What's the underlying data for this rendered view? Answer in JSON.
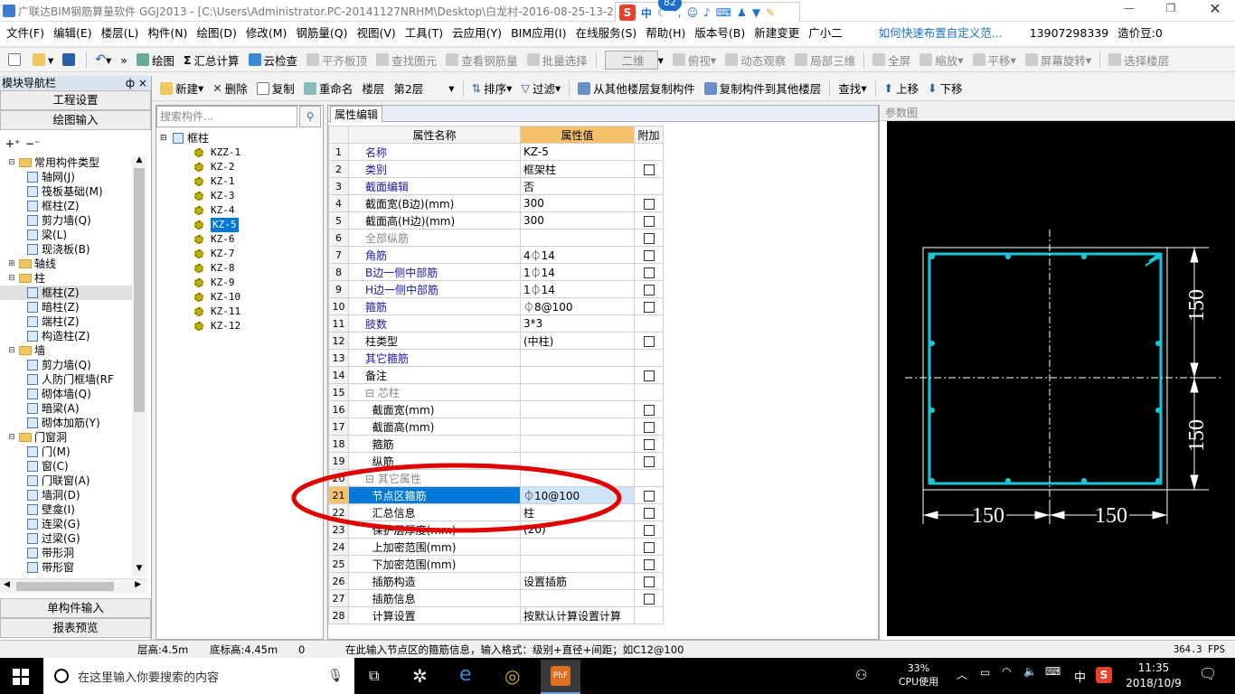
{
  "window": {
    "title": "广联达BIM钢筋算量软件 GGJ2013 - [C:\\Users\\Administrator.PC-20141127NRHM\\Desktop\\白龙村-2016-08-25-13-27",
    "ime_badge": "82",
    "ime_label": "中"
  },
  "menu": {
    "items": [
      "文件(F)",
      "编辑(E)",
      "楼层(L)",
      "构件(N)",
      "绘图(D)",
      "修改(M)",
      "钢筋量(Q)",
      "视图(V)",
      "工具(T)",
      "云应用(Y)",
      "BIM应用(I)",
      "在线服务(S)",
      "帮助(H)",
      "版本号(B)"
    ],
    "new_change": "新建变更",
    "assistant": "广小二",
    "help_link": "如何快速布置自定义范...",
    "phone": "13907298339",
    "bean": "造价豆:0"
  },
  "toolbar1": {
    "draw": "绘图",
    "sum": "汇总计算",
    "cloud_check": "云检查",
    "level_slab": "平齐板顶",
    "find_elem": "查找图元",
    "view_rebar": "查看钢筋量",
    "batch_select": "批量选择",
    "view_mode": "二维",
    "view_top": "俯视",
    "dynamic": "动态观察",
    "local3d": "局部三维",
    "fullscreen": "全屏",
    "zoom": "缩放",
    "pan": "平移",
    "rotate": "屏幕旋转",
    "select_floor": "选择楼层"
  },
  "toolbar2": {
    "new": "新建",
    "delete": "删除",
    "copy": "复制",
    "rename": "重命名",
    "floor_label": "楼层",
    "floor_value": "第2层",
    "sort": "排序",
    "filter": "过滤",
    "copy_from": "从其他楼层复制构件",
    "copy_to": "复制构件到其他楼层",
    "find": "查找",
    "up": "上移",
    "down": "下移"
  },
  "nav": {
    "header": "模块导航栏",
    "pin": "ф ×",
    "project_settings": "工程设置",
    "drawing_input": "绘图输入",
    "single_input": "单构件输入",
    "report_preview": "报表预览",
    "tree": [
      {
        "level": 0,
        "exp": "⊟",
        "folder": true,
        "label": "常用构件类型"
      },
      {
        "level": 1,
        "label": "轴网(J)"
      },
      {
        "level": 1,
        "label": "筏板基础(M)"
      },
      {
        "level": 1,
        "label": "框柱(Z)"
      },
      {
        "level": 1,
        "label": "剪力墙(Q)"
      },
      {
        "level": 1,
        "label": "梁(L)"
      },
      {
        "level": 1,
        "label": "现浇板(B)"
      },
      {
        "level": 0,
        "exp": "⊞",
        "folder": true,
        "label": "轴线"
      },
      {
        "level": 0,
        "exp": "⊟",
        "folder": true,
        "label": "柱"
      },
      {
        "level": 1,
        "label": "框柱(Z)",
        "selected": true
      },
      {
        "level": 1,
        "label": "暗柱(Z)"
      },
      {
        "level": 1,
        "label": "端柱(Z)"
      },
      {
        "level": 1,
        "label": "构造柱(Z)"
      },
      {
        "level": 0,
        "exp": "⊟",
        "folder": true,
        "label": "墙"
      },
      {
        "level": 1,
        "label": "剪力墙(Q)"
      },
      {
        "level": 1,
        "label": "人防门框墙(RF"
      },
      {
        "level": 1,
        "label": "砌体墙(Q)"
      },
      {
        "level": 1,
        "label": "暗梁(A)"
      },
      {
        "level": 1,
        "label": "砌体加筋(Y)"
      },
      {
        "level": 0,
        "exp": "⊟",
        "folder": true,
        "label": "门窗洞"
      },
      {
        "level": 1,
        "label": "门(M)"
      },
      {
        "level": 1,
        "label": "窗(C)"
      },
      {
        "level": 1,
        "label": "门联窗(A)"
      },
      {
        "level": 1,
        "label": "墙洞(D)"
      },
      {
        "level": 1,
        "label": "壁龛(I)"
      },
      {
        "level": 1,
        "label": "连梁(G)"
      },
      {
        "level": 1,
        "label": "过梁(G)"
      },
      {
        "level": 1,
        "label": "带形洞"
      },
      {
        "level": 1,
        "label": "带形窗"
      }
    ]
  },
  "components": {
    "search_placeholder": "搜索构件...",
    "root": "框柱",
    "items": [
      "KZZ-1",
      "KZ-2",
      "KZ-1",
      "KZ-3",
      "KZ-4",
      "KZ-5",
      "KZ-6",
      "KZ-7",
      "KZ-8",
      "KZ-9",
      "KZ-10",
      "KZ-11",
      "KZ-12"
    ],
    "selected_index": 5
  },
  "props": {
    "tab": "属性编辑",
    "col_name": "属性名称",
    "col_value": "属性值",
    "col_extra": "附加",
    "rows": [
      {
        "n": "1",
        "name": "名称",
        "value": "KZ-5",
        "style": "blue",
        "cb": false
      },
      {
        "n": "2",
        "name": "类别",
        "value": "框架柱",
        "style": "blue",
        "cb": true
      },
      {
        "n": "3",
        "name": "截面编辑",
        "value": "否",
        "style": "blue",
        "cb": false
      },
      {
        "n": "4",
        "name": "截面宽(B边)(mm)",
        "value": "300",
        "style": "",
        "cb": true
      },
      {
        "n": "5",
        "name": "截面高(H边)(mm)",
        "value": "300",
        "style": "",
        "cb": true
      },
      {
        "n": "6",
        "name": "全部纵筋",
        "value": "",
        "style": "gray",
        "cb": true
      },
      {
        "n": "7",
        "name": "角筋",
        "value": "4⏀14",
        "style": "blue",
        "cb": true
      },
      {
        "n": "8",
        "name": "B边一侧中部筋",
        "value": "1⏀14",
        "style": "blue",
        "cb": true
      },
      {
        "n": "9",
        "name": "H边一侧中部筋",
        "value": "1⏀14",
        "style": "blue",
        "cb": true
      },
      {
        "n": "10",
        "name": "箍筋",
        "value": "⏀8@100",
        "style": "blue",
        "cb": true
      },
      {
        "n": "11",
        "name": "肢数",
        "value": "3*3",
        "style": "blue",
        "cb": false
      },
      {
        "n": "12",
        "name": "柱类型",
        "value": "(中柱)",
        "style": "",
        "cb": true
      },
      {
        "n": "13",
        "name": "其它箍筋",
        "value": "",
        "style": "blue",
        "cb": false
      },
      {
        "n": "14",
        "name": "备注",
        "value": "",
        "style": "",
        "cb": true
      },
      {
        "n": "15",
        "name": "⊟ 芯柱",
        "value": "",
        "style": "gray",
        "cb": false
      },
      {
        "n": "16",
        "name": "  截面宽(mm)",
        "value": "",
        "style": "",
        "cb": true
      },
      {
        "n": "17",
        "name": "  截面高(mm)",
        "value": "",
        "style": "",
        "cb": true
      },
      {
        "n": "18",
        "name": "  箍筋",
        "value": "",
        "style": "",
        "cb": true
      },
      {
        "n": "19",
        "name": "  纵筋",
        "value": "",
        "style": "",
        "cb": true
      },
      {
        "n": "20",
        "name": "⊟ 其它属性",
        "value": "",
        "style": "gray",
        "cb": false
      },
      {
        "n": "21",
        "name": "  节点区箍筋",
        "value": "⏀10@100",
        "style": "sel",
        "cb": true
      },
      {
        "n": "22",
        "name": "  汇总信息",
        "value": "柱",
        "style": "",
        "cb": true
      },
      {
        "n": "23",
        "name": "  保护层厚度(mm)",
        "value": "(20)",
        "style": "",
        "cb": true
      },
      {
        "n": "24",
        "name": "  上加密范围(mm)",
        "value": "",
        "style": "",
        "cb": true
      },
      {
        "n": "25",
        "name": "  下加密范围(mm)",
        "value": "",
        "style": "",
        "cb": true
      },
      {
        "n": "26",
        "name": "  插筋构造",
        "value": "设置插筋",
        "style": "",
        "cb": true
      },
      {
        "n": "27",
        "name": "  插筋信息",
        "value": "",
        "style": "",
        "cb": true
      },
      {
        "n": "28",
        "name": "  计算设置",
        "value": "按默认计算设置计算",
        "style": "",
        "cb": false
      }
    ]
  },
  "paramfig": {
    "title": "参数图",
    "dim_right_top": "150",
    "dim_right_bottom": "150",
    "dim_bottom_left": "150",
    "dim_bottom_right": "150"
  },
  "status": {
    "floor_height": "层高:4.5m",
    "bottom_height": "底标高:4.45m",
    "zero": "0",
    "hint": "在此输入节点区的箍筋信息，输入格式：级别+直径+间距；如C12@100",
    "fps": "364.3 FPS"
  },
  "taskbar": {
    "search": "在这里输入你要搜索的内容",
    "cpu_pct": "33%",
    "cpu_label": "CPU使用",
    "lang": "中",
    "time": "11:35",
    "date": "2018/10/9"
  },
  "colors": {
    "accent": "#3a7bd5",
    "highlight_row": "#0078d7",
    "annotation_ellipse": "#e00000",
    "rebar_cyan": "#18c8d8",
    "header_orange": "#f4c06a"
  }
}
